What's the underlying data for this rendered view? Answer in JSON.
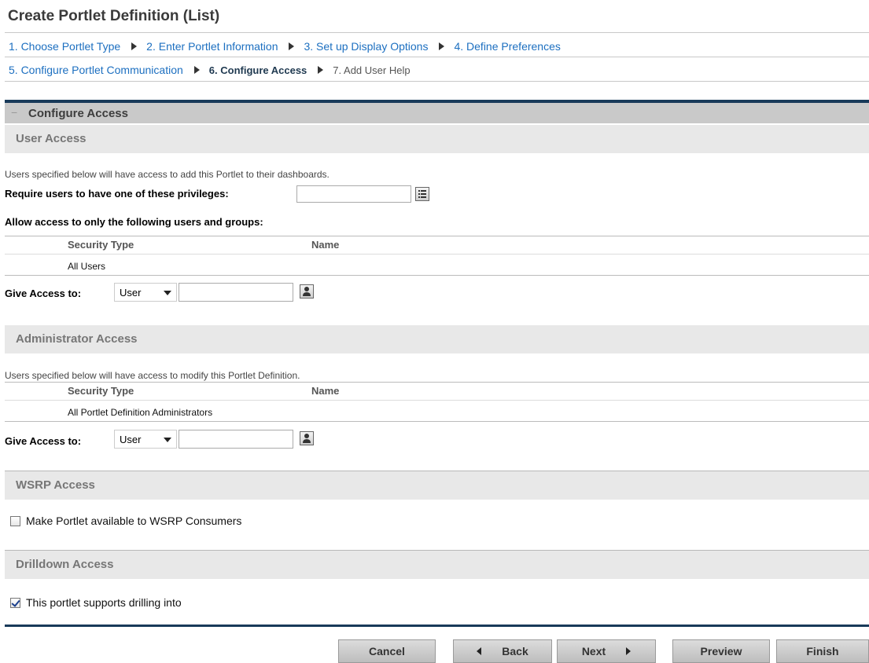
{
  "page_title": "Create Portlet Definition (List)",
  "steps_row1": [
    {
      "label": "1. Choose Portlet Type"
    },
    {
      "label": "2. Enter Portlet Information"
    },
    {
      "label": "3. Set up Display Options"
    },
    {
      "label": "4. Define Preferences"
    }
  ],
  "steps_row2": [
    {
      "label": "5. Configure Portlet Communication"
    },
    {
      "label": "6. Configure Access"
    },
    {
      "label": "7. Add User Help"
    }
  ],
  "section": {
    "collapse_glyph": "−",
    "title": "Configure Access"
  },
  "user_access": {
    "title": "User Access",
    "description": "Users specified below will have access to add this Portlet to their dashboards.",
    "privileges_label": "Require users to have one of these privileges:",
    "privileges_value": "",
    "allow_label": "Allow access to only the following users and groups:",
    "columns": [
      "Security Type",
      "Name"
    ],
    "rows": [
      {
        "security_type": "All Users",
        "name": ""
      }
    ],
    "give_access_label": "Give Access to:",
    "give_access_select": "User",
    "give_access_value": ""
  },
  "admin_access": {
    "title": "Administrator Access",
    "description": "Users specified below will have access to modify this Portlet Definition.",
    "columns": [
      "Security Type",
      "Name"
    ],
    "rows": [
      {
        "security_type": "All Portlet Definition Administrators",
        "name": ""
      }
    ],
    "give_access_label": "Give Access to:",
    "give_access_select": "User",
    "give_access_value": ""
  },
  "wsrp_access": {
    "title": "WSRP Access",
    "checkbox_label": "Make Portlet available to WSRP Consumers",
    "checked": false
  },
  "drilldown_access": {
    "title": "Drilldown Access",
    "checkbox_label": "This portlet supports drilling into",
    "checked": true
  },
  "buttons": {
    "cancel": "Cancel",
    "back": "Back",
    "next": "Next",
    "preview": "Preview",
    "finish": "Finish"
  },
  "colors": {
    "accent_bar": "#183a59",
    "link": "#1c6fc0",
    "section_header_bg": "#c9c9c9",
    "sub_header_bg": "#e8e8e8"
  }
}
